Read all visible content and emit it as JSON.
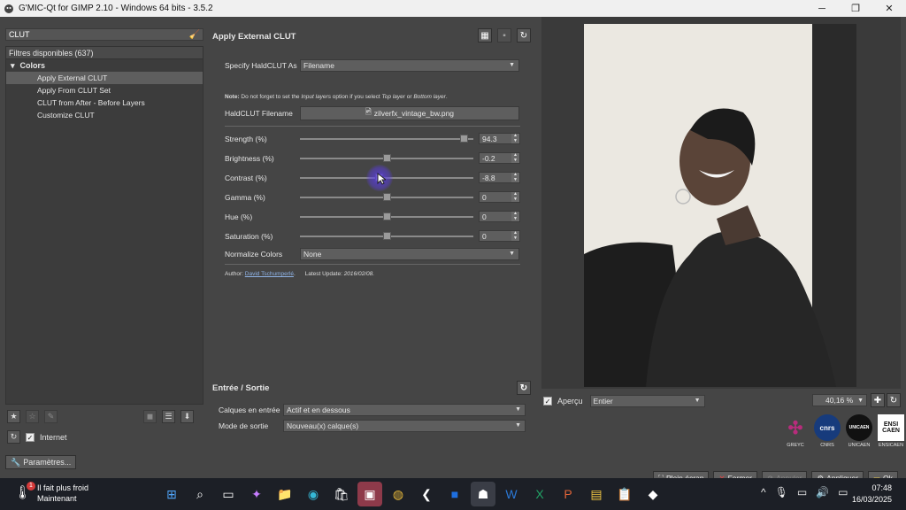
{
  "window": {
    "title": "G'MIC-Qt for GIMP 2.10 - Windows 64 bits - 3.5.2",
    "minimize": "─",
    "maximize": "❐",
    "close": "✕"
  },
  "left_panel": {
    "search_value": "CLUT",
    "filters_header": "Filtres disponibles (637)",
    "folder": "Colors",
    "items": [
      {
        "label": "Apply External CLUT",
        "selected": true
      },
      {
        "label": "Apply From CLUT Set",
        "selected": false
      },
      {
        "label": "CLUT from After - Before Layers",
        "selected": false
      },
      {
        "label": "Customize CLUT",
        "selected": false
      }
    ],
    "internet_label": "Internet",
    "params_button": "Paramètres..."
  },
  "filter": {
    "title": "Apply External CLUT",
    "specify_label": "Specify HaldCLUT As",
    "specify_value": "Filename",
    "note_prefix": "Note:",
    "note_text": "Do not forget to set the",
    "note_input_layers": "Input layers",
    "note_text2": "option if you select",
    "note_top_layer": "Top layer",
    "note_or": "or",
    "note_bottom_layer": "Bottom layer",
    "note_end": ".",
    "filename_label": "HaldCLUT Filename",
    "filename_value": "zilverfx_vintage_bw.png",
    "sliders": [
      {
        "label": "Strength (%)",
        "value": "94.3",
        "fraction": 0.943
      },
      {
        "label": "Brightness (%)",
        "value": "-0.2",
        "fraction": 0.499
      },
      {
        "label": "Contrast (%)",
        "value": "-8.8",
        "fraction": 0.456
      },
      {
        "label": "Gamma (%)",
        "value": "0",
        "fraction": 0.5
      },
      {
        "label": "Hue (%)",
        "value": "0",
        "fraction": 0.5
      },
      {
        "label": "Saturation (%)",
        "value": "0",
        "fraction": 0.5
      }
    ],
    "normalize_label": "Normalize Colors",
    "normalize_value": "None",
    "author_prefix": "Author:",
    "author_name": "David Tschumperlé",
    "latest_update_label": "Latest Update:",
    "latest_update_value": "2016/02/08."
  },
  "io": {
    "title": "Entrée / Sortie",
    "input_label": "Calques en entrée",
    "input_value": "Actif et en dessous",
    "output_label": "Mode de sortie",
    "output_value": "Nouveau(x) calque(s)"
  },
  "preview": {
    "apercu_label": "Aperçu",
    "mode_value": "Entier",
    "zoom_value": "40,16 %"
  },
  "logos": [
    {
      "label": "GREYC",
      "mark": "✣"
    },
    {
      "label": "CNRS",
      "mark": "cnrs"
    },
    {
      "label": "UNICAEN",
      "mark": "UNICAEN"
    },
    {
      "label": "ENSICAEN",
      "mark": "ENSI CAEN"
    }
  ],
  "buttons": {
    "fullscreen": "Plein écran",
    "close": "Fermer",
    "cancel": "Annuler",
    "apply": "Appliquer",
    "ok": "Ok"
  },
  "taskbar": {
    "weather_line1": "Il fait plus froid",
    "weather_line2": "Maintenant",
    "weather_badge": "1",
    "time": "07:48",
    "date": "16/03/2025"
  },
  "colors": {
    "accent_link": "#8fb3e6",
    "cursor_highlight": "#5a3ce6"
  }
}
